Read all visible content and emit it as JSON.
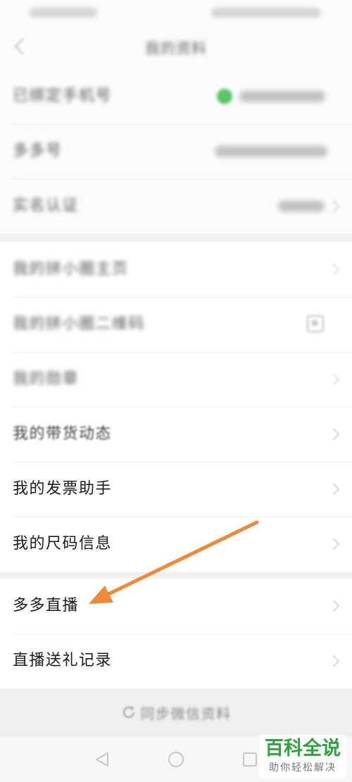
{
  "header": {
    "title": "我的资料",
    "back_icon": "chevron-left-icon"
  },
  "profile_rows": [
    {
      "label": "已绑定手机号"
    },
    {
      "label": "多多号"
    },
    {
      "label": "实名认证"
    }
  ],
  "feature_rows": [
    {
      "label": "我的拼小圈主页"
    },
    {
      "label": "我的拼小圈二维码",
      "icon": "qr-code-icon"
    },
    {
      "label": "我的勋章"
    },
    {
      "label": "我的带货动态"
    },
    {
      "label": "我的发票助手"
    },
    {
      "label": "我的尺码信息"
    }
  ],
  "live_rows": [
    {
      "label": "多多直播"
    },
    {
      "label": "直播送礼记录"
    }
  ],
  "footer": {
    "sync_button": "同步微信资料",
    "sync_icon": "refresh-icon"
  },
  "nav": {
    "back_icon": "nav-back-icon",
    "home_icon": "nav-home-icon",
    "recents_icon": "nav-recents-icon"
  },
  "watermark": {
    "title": "百科全说",
    "subtitle": "助你轻松解决"
  },
  "colors": {
    "annotation_arrow": "#f0883a",
    "watermark_green": "#2ea53c",
    "status_dot": "#5cc46a"
  }
}
